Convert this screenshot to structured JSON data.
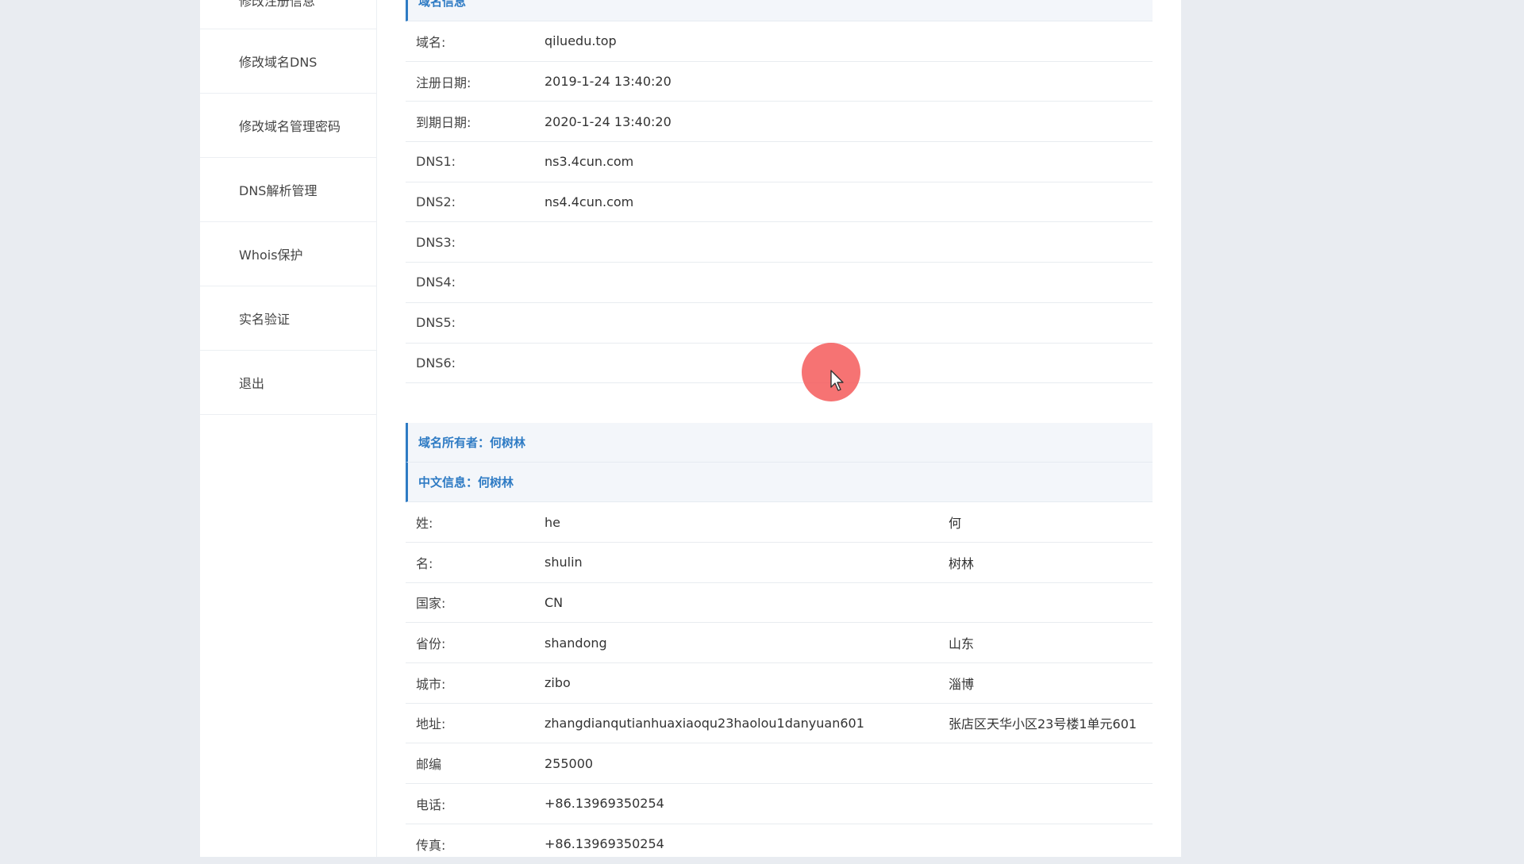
{
  "sidebar": {
    "items": [
      {
        "label": "修改注册信息"
      },
      {
        "label": "修改域名DNS"
      },
      {
        "label": "修改域名管理密码"
      },
      {
        "label": "DNS解析管理"
      },
      {
        "label": "Whois保护"
      },
      {
        "label": "实名验证"
      },
      {
        "label": "退出"
      }
    ]
  },
  "domain_info": {
    "title": "域名信息",
    "rows": [
      {
        "label": "域名:",
        "value": "qiluedu.top"
      },
      {
        "label": "注册日期:",
        "value": "2019-1-24 13:40:20"
      },
      {
        "label": "到期日期:",
        "value": "2020-1-24 13:40:20"
      },
      {
        "label": "DNS1:",
        "value": "ns3.4cun.com"
      },
      {
        "label": "DNS2:",
        "value": "ns4.4cun.com"
      },
      {
        "label": "DNS3:",
        "value": ""
      },
      {
        "label": "DNS4:",
        "value": ""
      },
      {
        "label": "DNS5:",
        "value": ""
      },
      {
        "label": "DNS6:",
        "value": ""
      }
    ]
  },
  "owner": {
    "title": "域名所有者：何树林",
    "cn_title": "中文信息：何树林",
    "rows": [
      {
        "label": "姓:",
        "value": "he",
        "cn": "何"
      },
      {
        "label": "名:",
        "value": "shulin",
        "cn": "树林"
      },
      {
        "label": "国家:",
        "value": "CN",
        "cn": ""
      },
      {
        "label": "省份:",
        "value": "shandong",
        "cn": "山东"
      },
      {
        "label": "城市:",
        "value": "zibo",
        "cn": "淄博"
      },
      {
        "label": "地址:",
        "value": "zhangdianqutianhuaxiaoqu23haolou1danyuan601",
        "cn": "张店区天华小区23号楼1单元601"
      },
      {
        "label": "邮编",
        "value": "255000",
        "cn": ""
      },
      {
        "label": "电话:",
        "value": "+86.13969350254",
        "cn": ""
      },
      {
        "label": "传真:",
        "value": "+86.13969350254",
        "cn": ""
      }
    ]
  },
  "colors": {
    "accent": "#2e7bc4",
    "cursor_highlight": "#f45a5a"
  }
}
